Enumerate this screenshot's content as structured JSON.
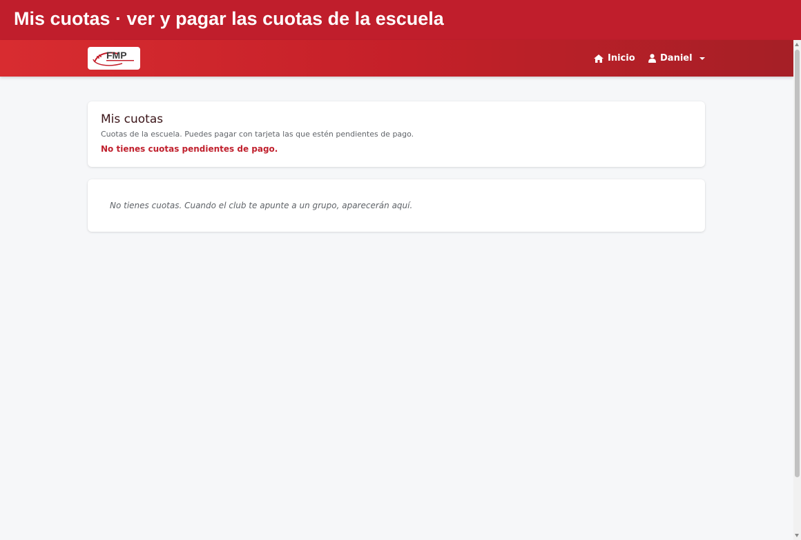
{
  "page_title": "Mis cuotas · ver y pagar las cuotas de la escuela",
  "navbar": {
    "logo_text": "FMP",
    "home_label": "Inicio",
    "user_label": "Daniel",
    "brand_color": "#c01e2c"
  },
  "summary_card": {
    "title": "Mis cuotas",
    "subtitle": "Cuotas de la escuela. Puedes pagar con tarjeta las que estén pendientes de pago.",
    "alert": "No tienes cuotas pendientes de pago."
  },
  "fees_card": {
    "empty_message": "No tienes cuotas. Cuando el club te apunte a un grupo, aparecerán aquí."
  }
}
